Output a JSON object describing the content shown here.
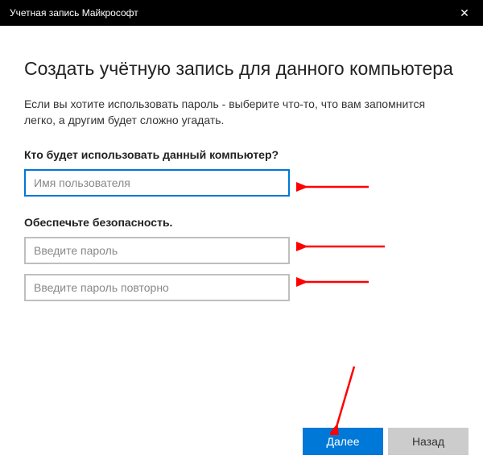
{
  "window": {
    "title": "Учетная запись Майкрософт"
  },
  "page": {
    "heading": "Создать учётную запись для данного компьютера",
    "description": "Если вы хотите использовать пароль - выберите что-то, что вам запомнится легко, а другим будет сложно угадать."
  },
  "section_user": {
    "label": "Кто будет использовать данный компьютер?",
    "username_placeholder": "Имя пользователя",
    "username_value": ""
  },
  "section_security": {
    "label": "Обеспечьте безопасность.",
    "password_placeholder": "Введите пароль",
    "password_value": "",
    "password_confirm_placeholder": "Введите пароль повторно",
    "password_confirm_value": ""
  },
  "buttons": {
    "next": "Далее",
    "back": "Назад"
  },
  "colors": {
    "accent": "#0078d7",
    "titlebar": "#000000",
    "annotation": "#ff0000"
  }
}
